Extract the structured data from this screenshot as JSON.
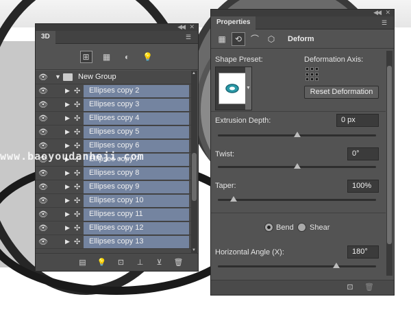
{
  "panel3d": {
    "tab": "3D",
    "filters": [
      "scene-filter-icon",
      "mesh-filter-icon",
      "material-filter-icon",
      "light-filter-icon"
    ],
    "group": "New Group",
    "layers": [
      "Ellipses copy 2",
      "Ellipses copy 3",
      "Ellipses copy 4",
      "Ellipses copy 5",
      "Ellipses copy 6",
      "Ellipses copy 7",
      "Ellipses copy 8",
      "Ellipses copy 9",
      "Ellipses copy 10",
      "Ellipses copy 11",
      "Ellipses copy 12",
      "Ellipses copy 13"
    ]
  },
  "props": {
    "tab": "Properties",
    "title": "Deform",
    "shape_preset": "Shape Preset:",
    "deformation_axis": "Deformation Axis:",
    "reset_btn": "Reset Deformation",
    "extrusion_label": "Extrusion Depth:",
    "extrusion_value": "0 px",
    "extrusion_level": 0.5,
    "twist_label": "Twist:",
    "twist_value": "0°",
    "twist_level": 0.5,
    "taper_label": "Taper:",
    "taper_value": "100%",
    "taper_level": 0.1,
    "bend_label": "Bend",
    "shear_label": "Shear",
    "h_angle_label": "Horizontal Angle (X):",
    "h_angle_value": "180°",
    "h_angle_level": 0.75
  },
  "watermark": "www.baoyoudanheji.com"
}
